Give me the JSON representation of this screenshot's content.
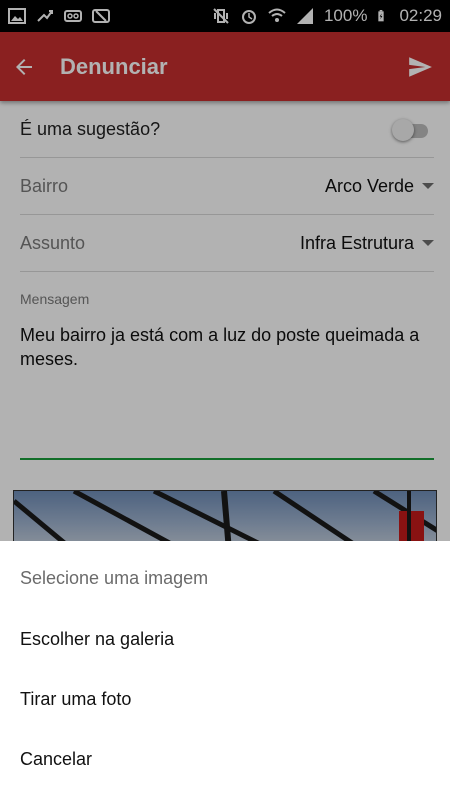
{
  "status_bar": {
    "battery": "100%",
    "time": "02:29",
    "left_icons": [
      "image-icon",
      "download-icon",
      "voicemail-icon",
      "sync-disabled-icon"
    ],
    "right_icons": [
      "vibrate-icon",
      "alarm-icon",
      "wifi-icon",
      "signal-icon",
      "battery-charging-icon"
    ]
  },
  "app_bar": {
    "title": "Denunciar",
    "back_icon": "arrow-back-icon",
    "send_icon": "send-icon",
    "color": "#c62f2f"
  },
  "form": {
    "suggestion": {
      "label": "É uma sugestão?",
      "on": false
    },
    "bairro": {
      "label": "Bairro",
      "value": "Arco Verde"
    },
    "assunto": {
      "label": "Assunto",
      "value": "Infra Estrutura"
    },
    "mensagem": {
      "label": "Mensagem",
      "value": "Meu bairro ja está com a luz do poste queimada a meses."
    }
  },
  "sheet": {
    "title": "Selecione uma imagem",
    "options": [
      "Escolher na galeria",
      "Tirar uma foto",
      "Cancelar"
    ]
  },
  "accent_color": "#1a9e3c"
}
